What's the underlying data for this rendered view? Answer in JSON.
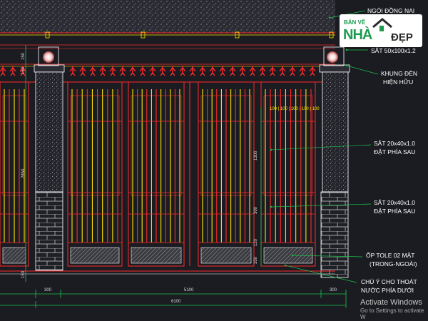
{
  "labels": {
    "top_partial": "NGÓI ĐỒNG NAI",
    "steel_cap": "SẮT 50x100x1.2",
    "lamp_frame_1": "KHUNG ĐÈN",
    "lamp_frame_2": "HIỆN HỮU",
    "steel_back_1a": "SẮT 20x40x1.0",
    "steel_back_1b": "ĐẶT PHÍA SAU",
    "steel_back_2a": "SẮT 20x40x1.0",
    "steel_back_2b": "ĐẶT PHÍA SAU",
    "tole_1": "ỐP TOLE 02 MẶT",
    "tole_2": "(TRONG-NGOÀI)",
    "drain_1": "CHÚ Ý CHO THOÁT",
    "drain_2": "NƯỚC PHÍA DƯỚI"
  },
  "dimensions": {
    "left_pier": "300",
    "opening": "5100",
    "right_pier": "300",
    "total": "6100",
    "height_left_1": "150",
    "height_left_2": "150",
    "height_left_3": "2850",
    "height_left_4": "150",
    "height_mid_1": "1300",
    "height_mid_2": "300",
    "height_mid_3": "120",
    "height_mid_4": "350",
    "panel_top": "100 | 100 | 100 | 100 | 100"
  },
  "logo": {
    "top": "BẢN VẼ",
    "main": "NHÀ",
    "right": "ĐẸP"
  },
  "watermark": {
    "line1": "Activate Windows",
    "line2": "Go to Settings to activate W"
  },
  "colors": {
    "background": "#1b1c22",
    "red": "#ff2a2a",
    "yellow": "#ffe600",
    "white": "#ffffff",
    "green": "#19c24a",
    "cyan": "#3de0ff"
  }
}
